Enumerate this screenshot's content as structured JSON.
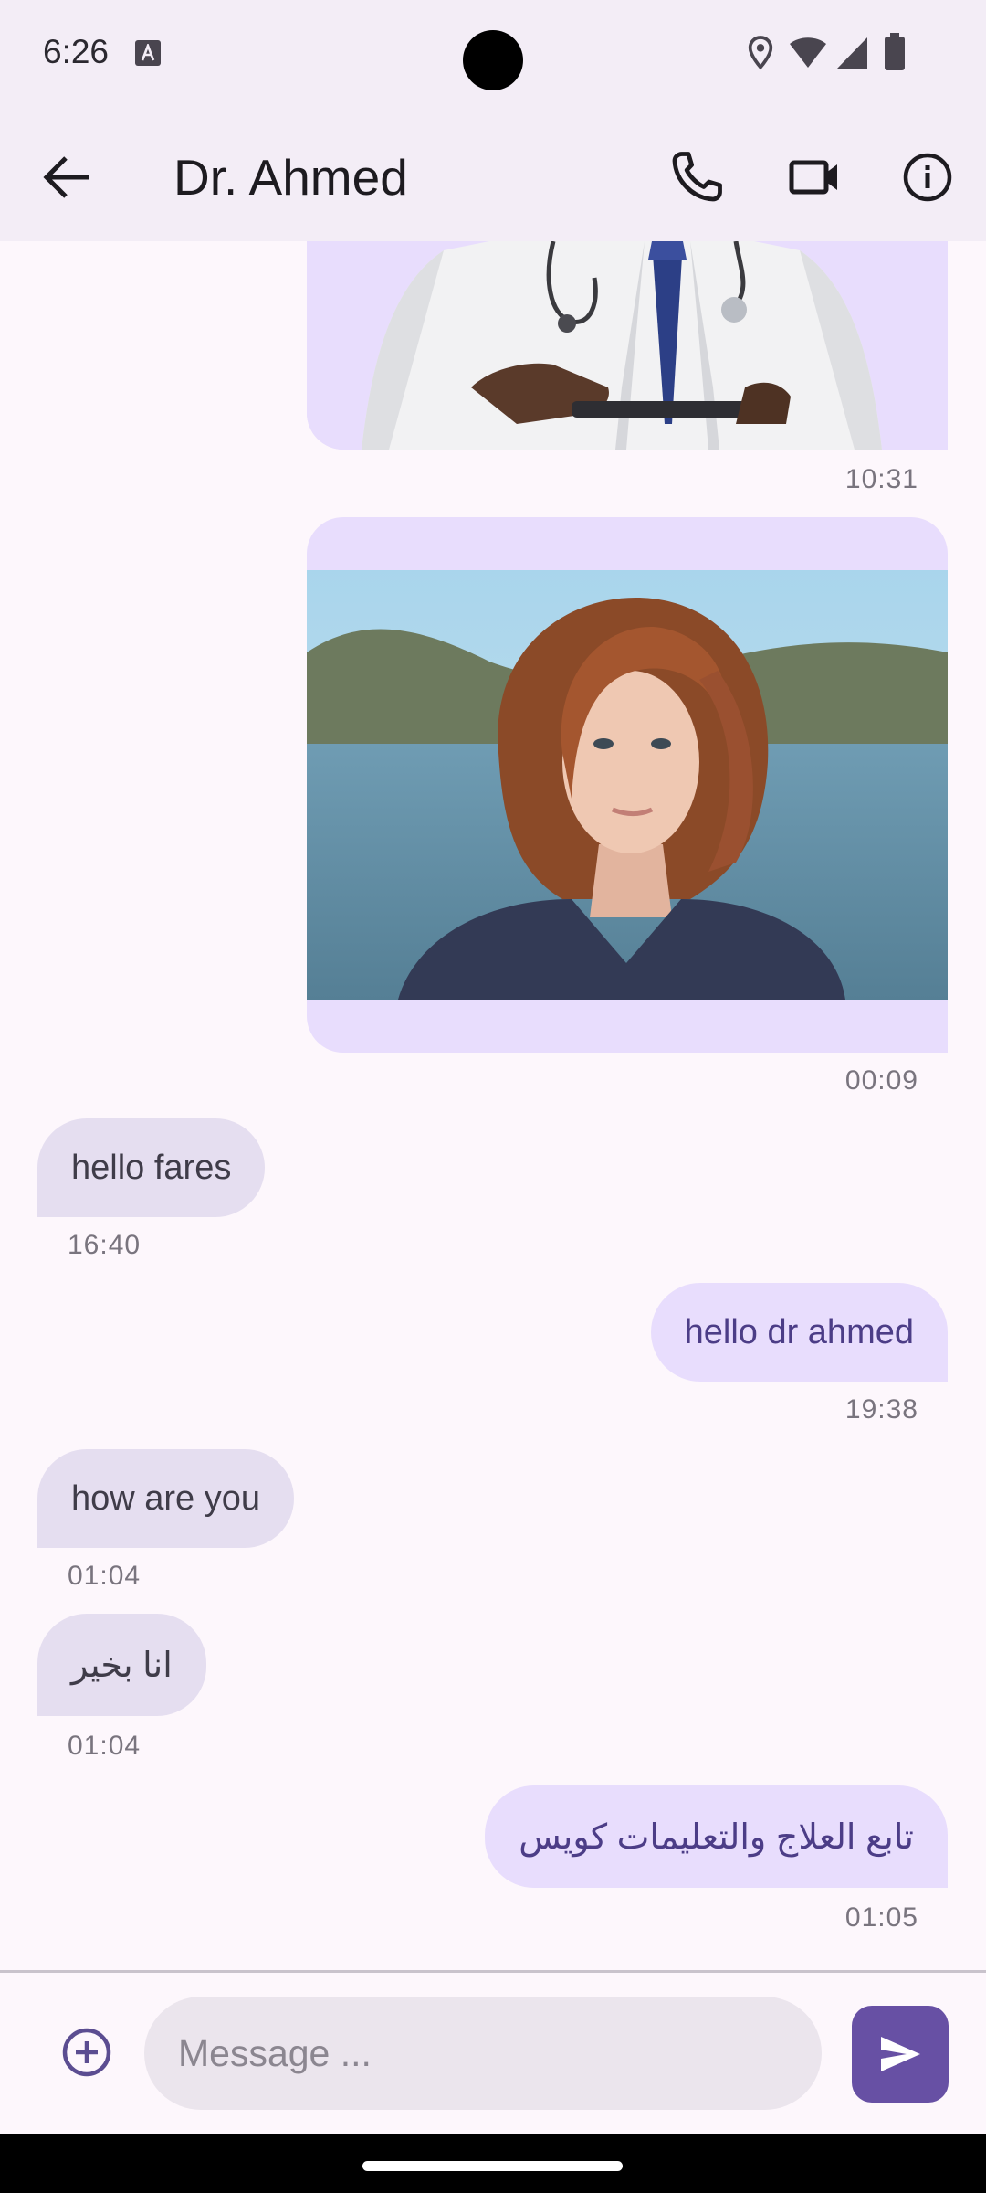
{
  "status_bar": {
    "time": "6:26",
    "icons": [
      "keyboard-a-icon",
      "location-icon",
      "wifi-icon",
      "signal-icon",
      "battery-icon"
    ]
  },
  "app_bar": {
    "title": "Dr. Ahmed",
    "icons": [
      "back-arrow-icon",
      "phone-icon",
      "video-camera-icon",
      "info-icon"
    ]
  },
  "messages": [
    {
      "type": "image",
      "direction": "outgoing",
      "image": "doctor-with-tablet",
      "time": "10:31"
    },
    {
      "type": "image",
      "direction": "outgoing",
      "image": "red-haired-woman-portrait",
      "time": "00:09"
    },
    {
      "type": "text",
      "direction": "incoming",
      "text": "hello fares",
      "time": "16:40"
    },
    {
      "type": "text",
      "direction": "outgoing",
      "text": "hello dr ahmed",
      "time": "19:38"
    },
    {
      "type": "text",
      "direction": "incoming",
      "text": "how are you",
      "time": "01:04"
    },
    {
      "type": "text",
      "direction": "incoming",
      "text": "انا بخير",
      "time": "01:04"
    },
    {
      "type": "text",
      "direction": "outgoing",
      "text": "تابع العلاج والتعليمات كويس",
      "time": "01:05"
    }
  ],
  "composer": {
    "placeholder": "Message ...",
    "value": "",
    "icons": [
      "add-circle-icon",
      "send-icon"
    ]
  },
  "colors": {
    "background": "#fdf7fc",
    "app_bar": "#f3edf6",
    "incoming_bubble": "#e5def0",
    "outgoing_bubble": "#e8ddfd",
    "accent": "#6750a4"
  }
}
